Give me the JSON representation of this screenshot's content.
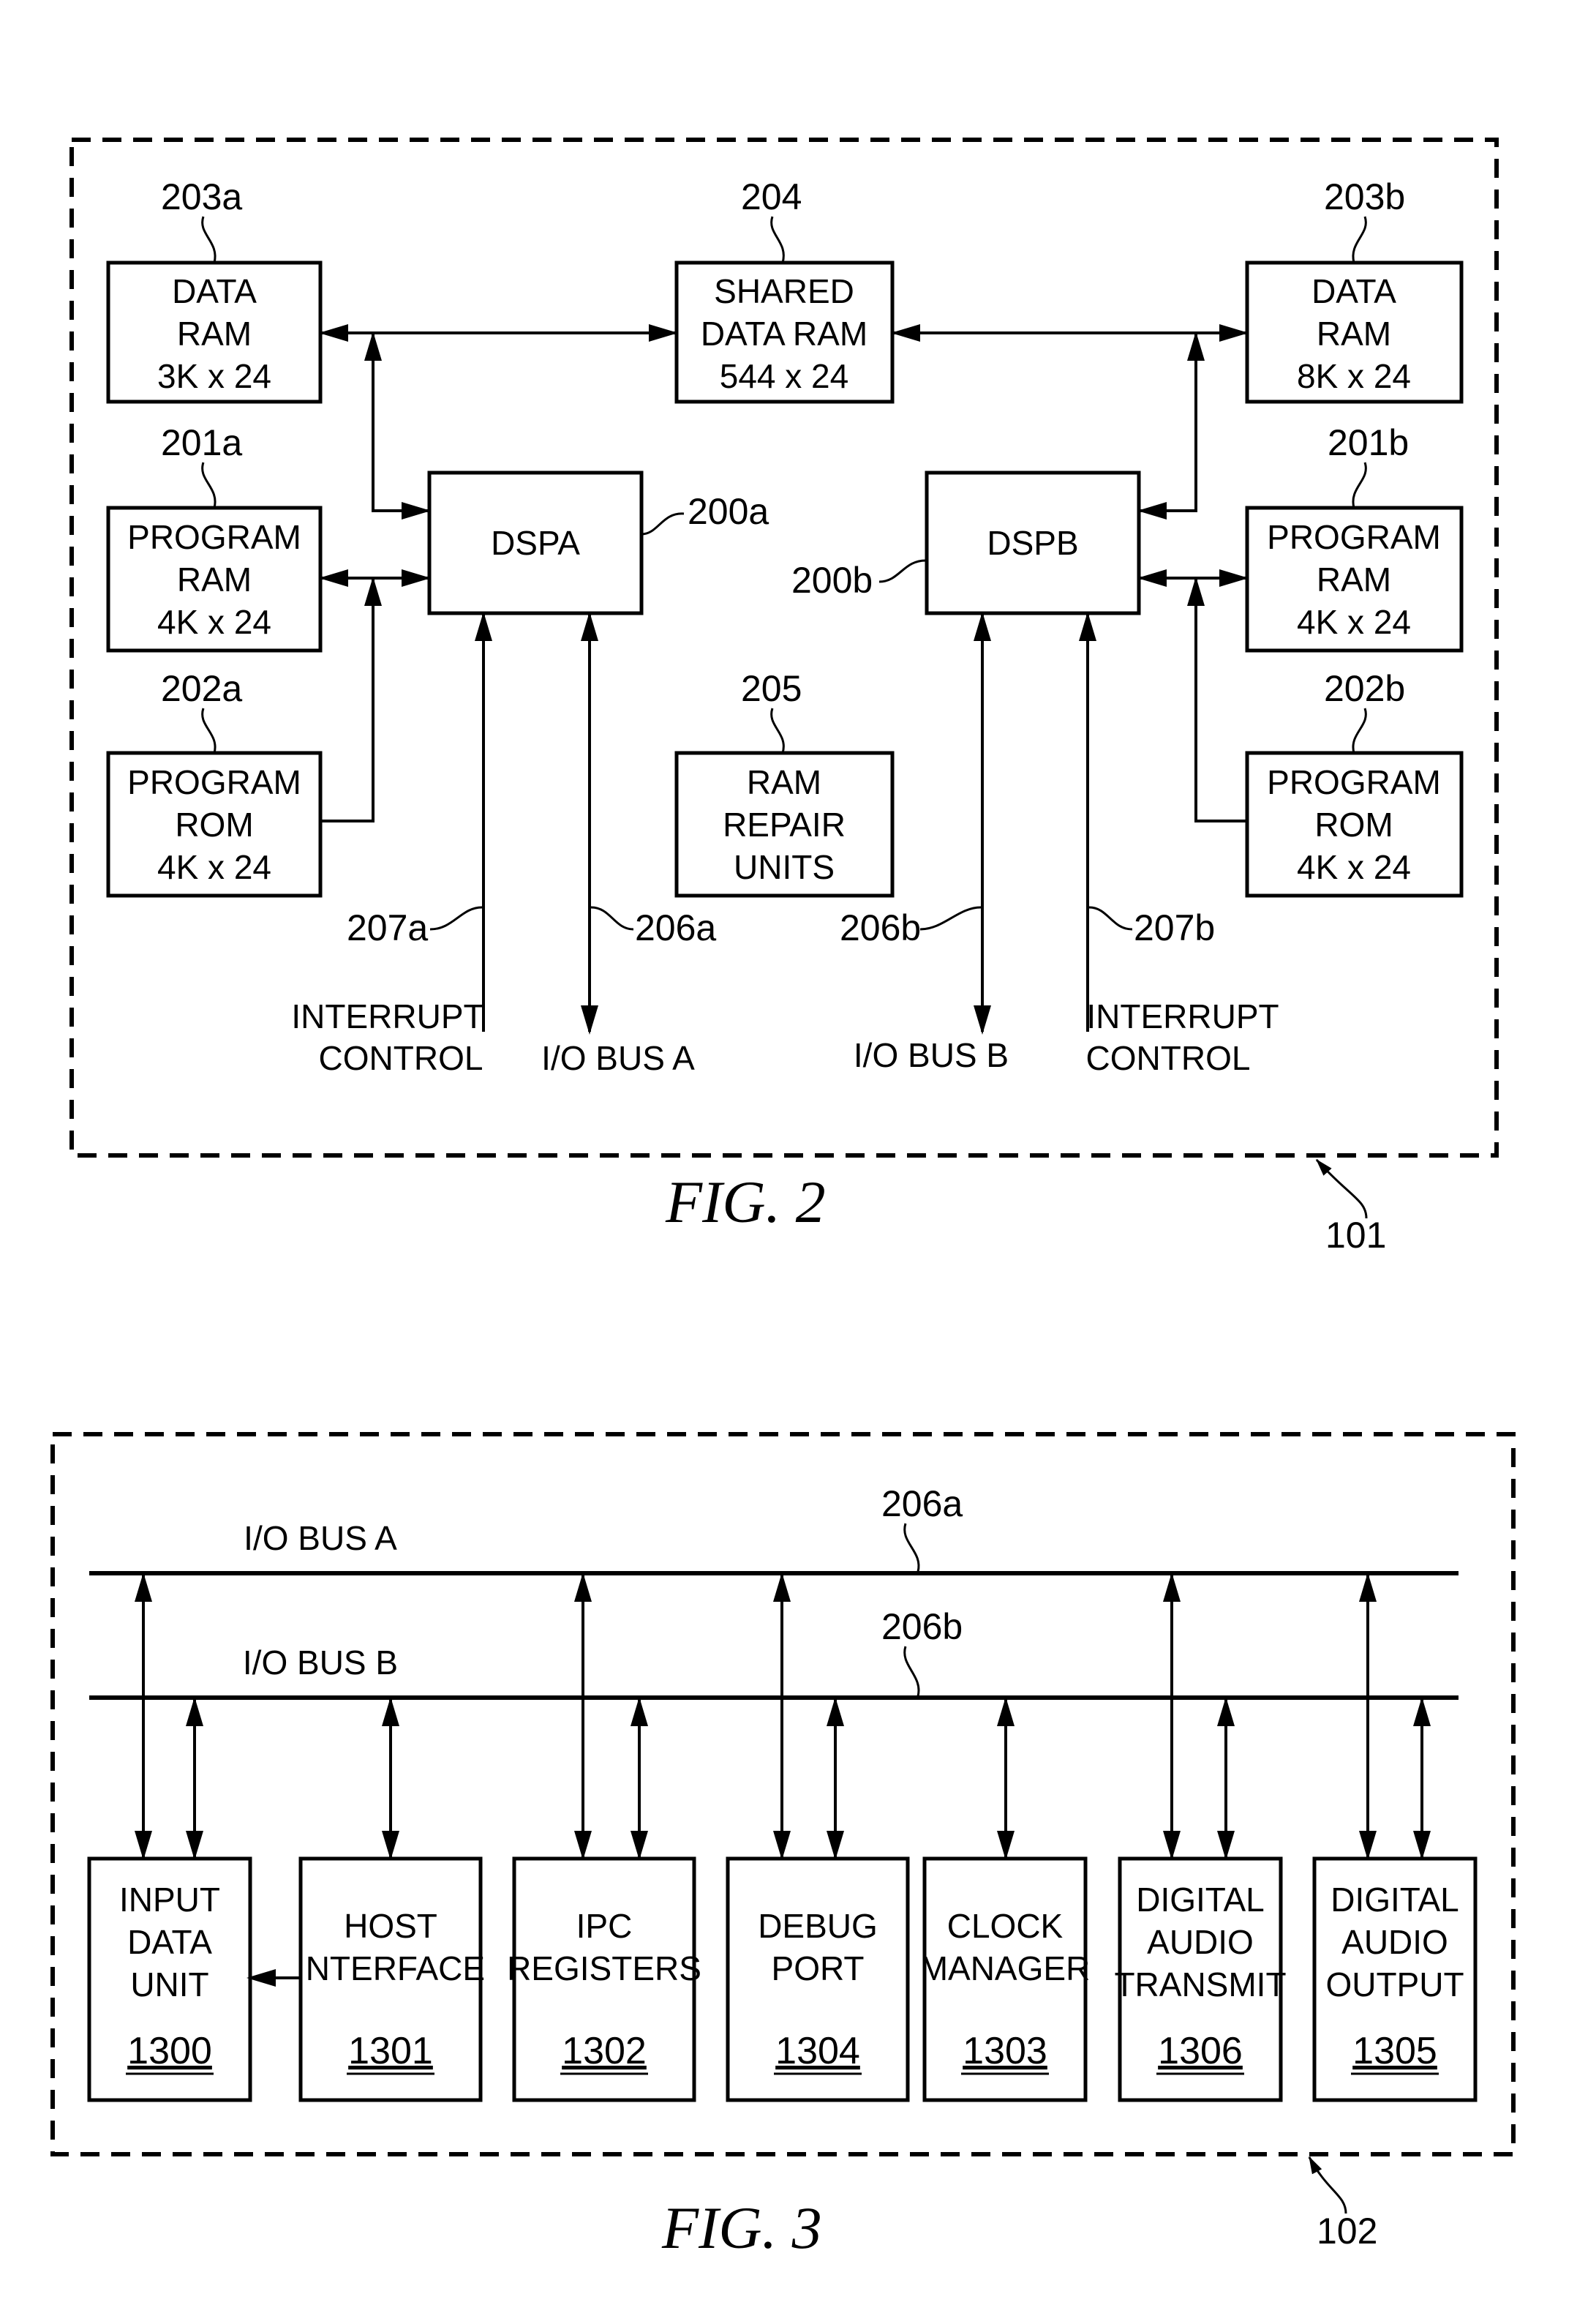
{
  "fig2": {
    "caption": "FIG. 2",
    "container_ref": "101",
    "blocks": {
      "data_ram_a": {
        "ref": "203a",
        "lines": [
          "DATA",
          "RAM",
          "3K x 24"
        ]
      },
      "shared_ram": {
        "ref": "204",
        "lines": [
          "SHARED",
          "DATA RAM",
          "544 x 24"
        ]
      },
      "data_ram_b": {
        "ref": "203b",
        "lines": [
          "DATA",
          "RAM",
          "8K x 24"
        ]
      },
      "prog_ram_a": {
        "ref": "201a",
        "lines": [
          "PROGRAM",
          "RAM",
          "4K x 24"
        ]
      },
      "dspa": {
        "ref": "200a",
        "lines": [
          "DSPA"
        ]
      },
      "dspb": {
        "ref": "200b",
        "lines": [
          "DSPB"
        ]
      },
      "prog_ram_b": {
        "ref": "201b",
        "lines": [
          "PROGRAM",
          "RAM",
          "4K x 24"
        ]
      },
      "prog_rom_a": {
        "ref": "202a",
        "lines": [
          "PROGRAM",
          "ROM",
          "4K x 24"
        ]
      },
      "ram_repair": {
        "ref": "205",
        "lines": [
          "RAM",
          "REPAIR",
          "UNITS"
        ]
      },
      "prog_rom_b": {
        "ref": "202b",
        "lines": [
          "PROGRAM",
          "ROM",
          "4K x 24"
        ]
      }
    },
    "signals": {
      "int_a": {
        "ref": "207a",
        "lines": [
          "INTERRUPT",
          "CONTROL"
        ]
      },
      "bus_a": {
        "ref": "206a",
        "lines": [
          "I/O BUS A"
        ]
      },
      "bus_b": {
        "ref": "206b",
        "lines": [
          "I/O BUS B"
        ]
      },
      "int_b": {
        "ref": "207b",
        "lines": [
          "INTERRUPT",
          "CONTROL"
        ]
      }
    }
  },
  "fig3": {
    "caption": "FIG. 3",
    "container_ref": "102",
    "bus_a": {
      "label": "I/O BUS A",
      "ref": "206a"
    },
    "bus_b": {
      "label": "I/O BUS B",
      "ref": "206b"
    },
    "units": [
      {
        "lines": [
          "INPUT",
          "DATA",
          "UNIT"
        ],
        "ref": "1300"
      },
      {
        "lines": [
          "HOST",
          "INTERFACE"
        ],
        "ref": "1301"
      },
      {
        "lines": [
          "IPC",
          "REGISTERS"
        ],
        "ref": "1302"
      },
      {
        "lines": [
          "DEBUG",
          "PORT"
        ],
        "ref": "1304"
      },
      {
        "lines": [
          "CLOCK",
          "MANAGER"
        ],
        "ref": "1303"
      },
      {
        "lines": [
          "DIGITAL",
          "AUDIO",
          "TRANSMIT"
        ],
        "ref": "1306"
      },
      {
        "lines": [
          "DIGITAL",
          "AUDIO",
          "OUTPUT"
        ],
        "ref": "1305"
      }
    ]
  }
}
